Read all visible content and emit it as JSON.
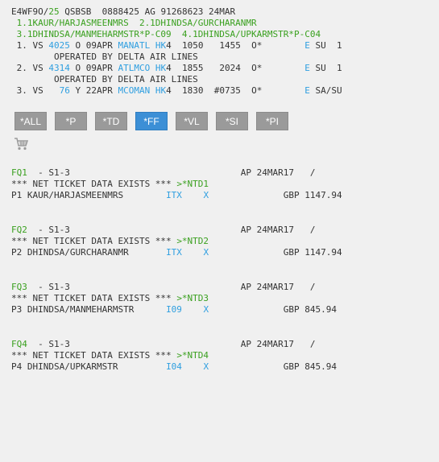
{
  "header": {
    "rec_locator": "E4WF9O",
    "sep": "/",
    "pax_count": "25",
    "rest": " QSBSB  0888425 AG 91268623 24MAR"
  },
  "names": {
    "line1": " 1.1KAUR/HARJASMEENMRS  2.1DHINDSA/GURCHARANMR",
    "line2": " 3.1DHINDSA/MANMEHARMSTR*P-C09  4.1DHINDSA/UPKARMSTR*P-C04"
  },
  "segments": [
    {
      "num": " 1. VS ",
      "flight": "4025",
      "cls": " O ",
      "date": "09APR ",
      "city": "MANATL",
      "sp1": " ",
      "status": "HK",
      "mid": "4  1050   1455  O*        ",
      "e": "E",
      "tail": " SU  1",
      "note": "        OPERATED BY DELTA AIR LINES"
    },
    {
      "num": " 2. VS ",
      "flight": "4314",
      "cls": " O ",
      "date": "09APR ",
      "city": "ATLMCO",
      "sp1": " ",
      "status": "HK",
      "mid": "4  1855   2024  O*        ",
      "e": "E",
      "tail": " SU  1",
      "note": "        OPERATED BY DELTA AIR LINES"
    },
    {
      "num": " 3. VS   ",
      "flight": "76",
      "cls": " Y ",
      "date": "22APR ",
      "city": "MCOMAN",
      "sp1": " ",
      "status": "HK",
      "mid": "4  1830  #0735  O*        ",
      "e": "E",
      "tail": " SA/SU",
      "note": ""
    }
  ],
  "toolbar": {
    "buttons": [
      "*ALL",
      "*P",
      "*TD",
      "*FF",
      "*VL",
      "*SI",
      "*PI"
    ],
    "active": "*FF"
  },
  "fares": [
    {
      "fq": "FQ1",
      "seg": "  - S1-3                                AP 24MAR17   /",
      "net": "*** NET TICKET DATA EXISTS *** ",
      "ntd": ">*NTD1",
      "pax": "P1 KAUR/HARJASMEENMRS        ",
      "type": "ITX",
      "gap": "    ",
      "x": "X",
      "amt": "              GBP 1147.94"
    },
    {
      "fq": "FQ2",
      "seg": "  - S1-3                                AP 24MAR17   /",
      "net": "*** NET TICKET DATA EXISTS *** ",
      "ntd": ">*NTD2",
      "pax": "P2 DHINDSA/GURCHARANMR       ",
      "type": "ITX",
      "gap": "    ",
      "x": "X",
      "amt": "              GBP 1147.94"
    },
    {
      "fq": "FQ3",
      "seg": "  - S1-3                                AP 24MAR17   /",
      "net": "*** NET TICKET DATA EXISTS *** ",
      "ntd": ">*NTD3",
      "pax": "P3 DHINDSA/MANMEHARMSTR      ",
      "type": "I09",
      "gap": "    ",
      "x": "X",
      "amt": "              GBP 845.94"
    },
    {
      "fq": "FQ4",
      "seg": "  - S1-3                                AP 24MAR17   /",
      "net": "*** NET TICKET DATA EXISTS *** ",
      "ntd": ">*NTD4",
      "pax": "P4 DHINDSA/UPKARMSTR         ",
      "type": "I04",
      "gap": "    ",
      "x": "X",
      "amt": "              GBP 845.94"
    }
  ],
  "icons": {
    "cart": "shopping-cart-icon"
  },
  "colors": {
    "green": "#3aa01f",
    "blue": "#2f9fe0",
    "active_button": "#3c8fd6",
    "button": "#9a9a9a"
  }
}
